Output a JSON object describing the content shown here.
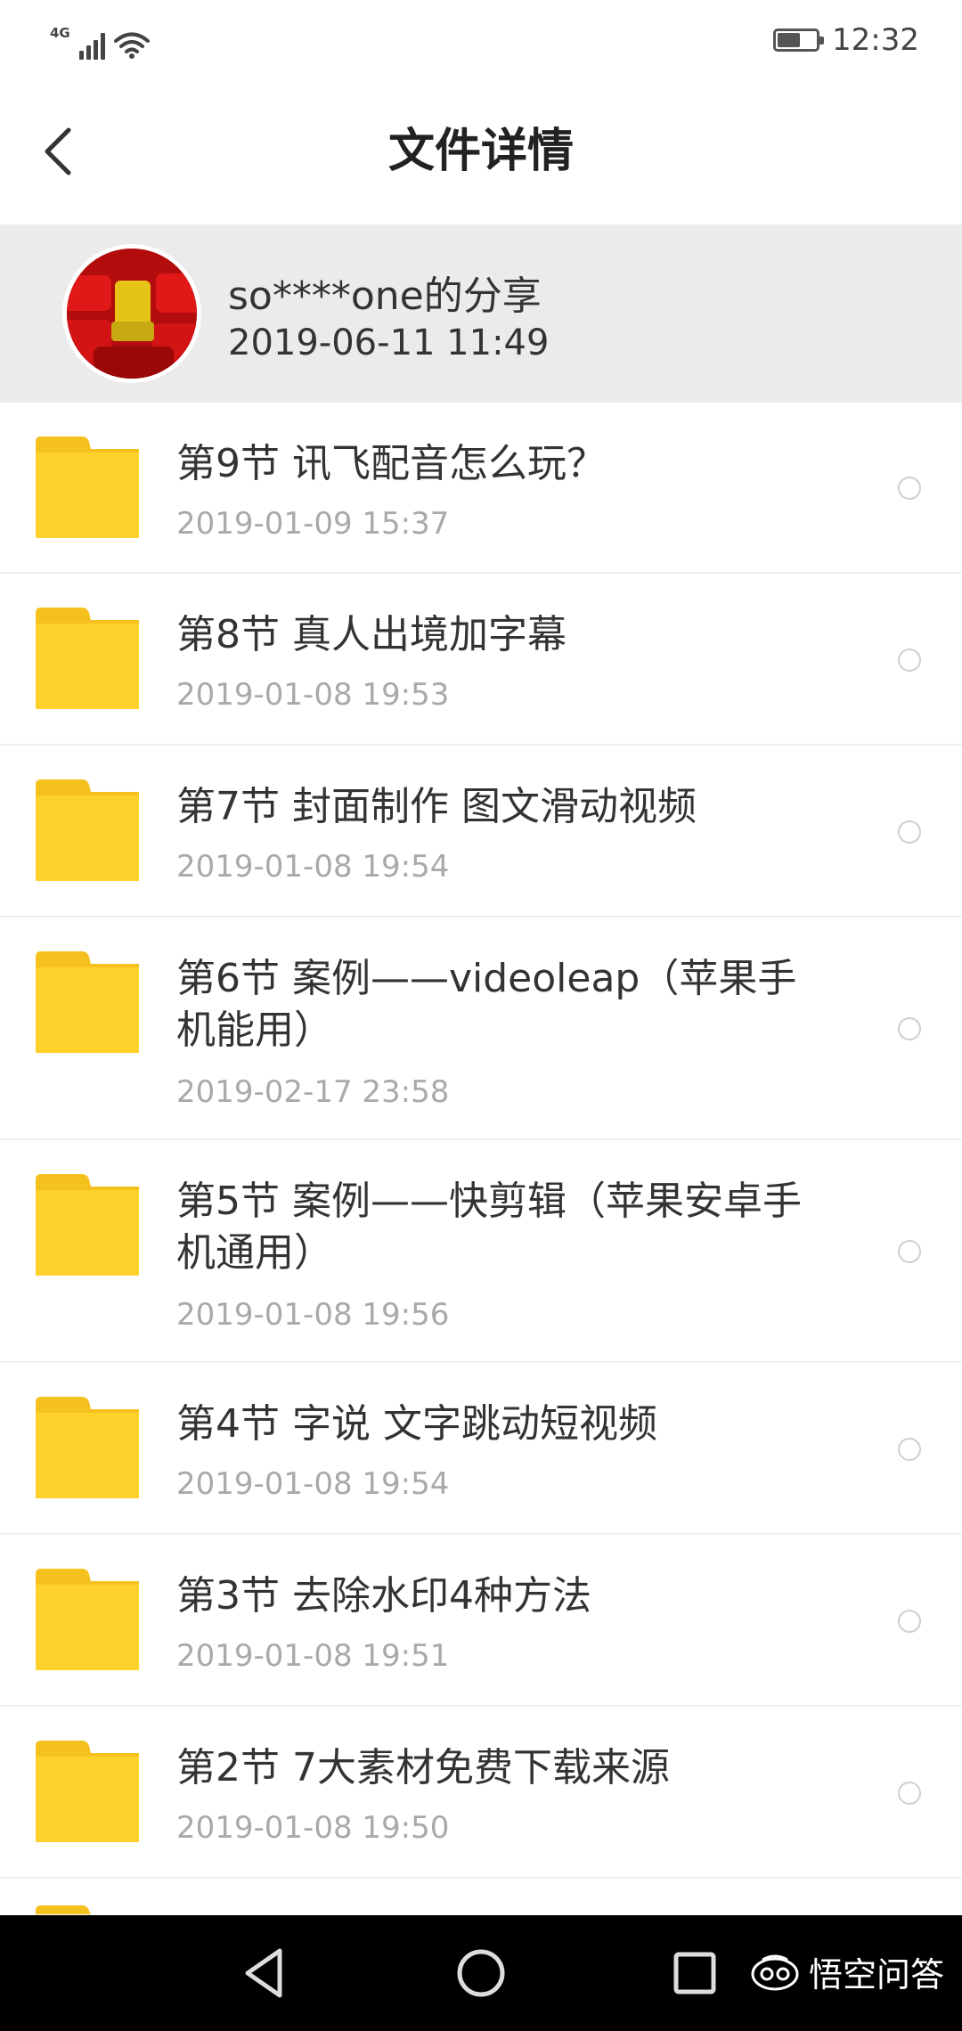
{
  "status_bar": {
    "network": "4G",
    "time": "12:32",
    "battery_level": 0.6,
    "icons": [
      "signal-icon",
      "wifi-icon",
      "battery-icon"
    ]
  },
  "header": {
    "title": "文件详情",
    "back_icon": "chevron-left-icon"
  },
  "share": {
    "owner": "so****one的分享",
    "datetime": "2019-06-11  11:49",
    "avatar_colors": [
      "#c41010",
      "#e6c416"
    ]
  },
  "files": [
    {
      "name": "第9节 讯飞配音怎么玩？",
      "date": "2019-01-09  15:37"
    },
    {
      "name": "第8节 真人出境加字幕",
      "date": "2019-01-08  19:53"
    },
    {
      "name": "第7节  封面制作 图文滑动视频",
      "date": "2019-01-08  19:54"
    },
    {
      "name": "第6节 案例——videoleap（苹果手机能用）",
      "date": "2019-02-17  23:58"
    },
    {
      "name": "第5节 案例——快剪辑（苹果安卓手机通用）",
      "date": "2019-01-08  19:56"
    },
    {
      "name": "第4节 字说 文字跳动短视频",
      "date": "2019-01-08  19:54"
    },
    {
      "name": "第3节 去除水印4种方法",
      "date": "2019-01-08  19:51"
    },
    {
      "name": "第2节  7大素材免费下载来源",
      "date": "2019-01-08  19:50"
    }
  ],
  "colors": {
    "folder": "#ffd12b",
    "folder_tab": "#f5c11f",
    "header_bg": "#ebebeb",
    "date_text": "#a9a9a9"
  },
  "nav_bar": {
    "buttons": [
      "back-triangle-icon",
      "home-circle-icon",
      "recents-square-icon"
    ],
    "watermark": "悟空问答"
  }
}
